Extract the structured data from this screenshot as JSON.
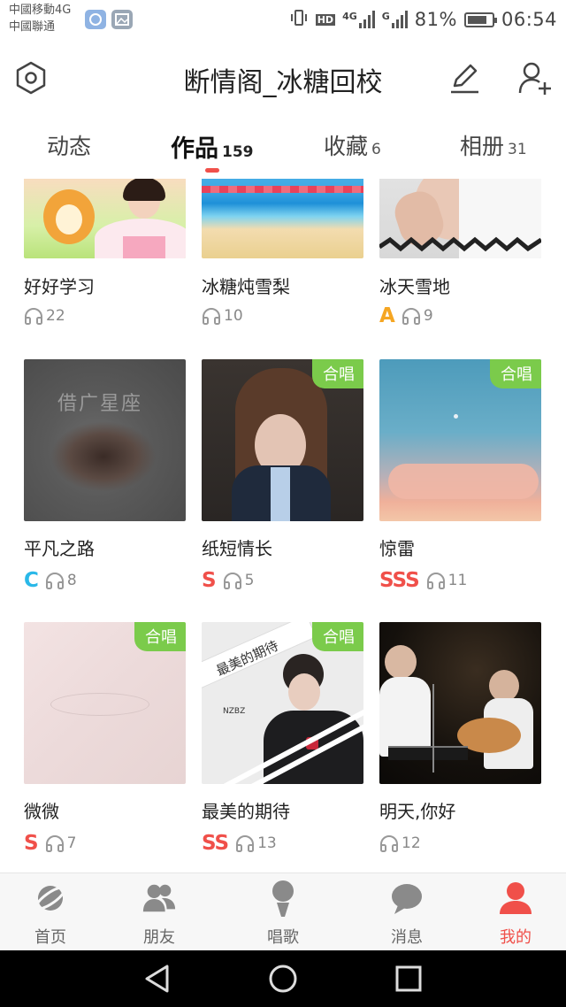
{
  "status_bar": {
    "carrier1": "中國移動4G",
    "carrier2": "中國聯通",
    "hd": "HD",
    "net1": "4G",
    "net2": "G",
    "battery": "81%",
    "battery_level": 0.81,
    "time": "06:54"
  },
  "header": {
    "title": "断情阁_冰糖回校",
    "left_icon": "settings-hexagon-icon",
    "right_icons": [
      "edit-pencil-icon",
      "add-friend-icon"
    ]
  },
  "tabs": [
    {
      "label": "动态",
      "count": ""
    },
    {
      "label": "作品",
      "count": "159",
      "active": true
    },
    {
      "label": "收藏",
      "count": "6"
    },
    {
      "label": "相册",
      "count": "31"
    }
  ],
  "duet_label": "合唱",
  "works": [
    {
      "title": "好好学习",
      "grade": "",
      "plays": "22",
      "duet": false
    },
    {
      "title": "冰糖炖雪梨",
      "grade": "",
      "plays": "10",
      "duet": false
    },
    {
      "title": "冰天雪地",
      "grade": "A",
      "plays": "9",
      "duet": false
    },
    {
      "title": "平凡之路",
      "grade": "C",
      "plays": "8",
      "duet": false
    },
    {
      "title": "纸短情长",
      "grade": "S",
      "plays": "5",
      "duet": true
    },
    {
      "title": "惊雷",
      "grade": "SSS",
      "plays": "11",
      "duet": true
    },
    {
      "title": "微微",
      "grade": "S",
      "plays": "7",
      "duet": true
    },
    {
      "title": "最美的期待",
      "grade": "SS",
      "plays": "13",
      "duet": true
    },
    {
      "title": "明天,你好",
      "grade": "",
      "plays": "12",
      "duet": false
    }
  ],
  "cover_texts": {
    "w3": "借广星座",
    "w7_banner": "最美的期待",
    "w7_tag": "NZBZ"
  },
  "grade_colors": {
    "A": "#f5a623",
    "C": "#2ab8e8",
    "S": "#f0504a",
    "SS": "#f0504a",
    "SSS": "#f0504a"
  },
  "bottom_nav": [
    {
      "label": "首页",
      "icon": "planet-icon"
    },
    {
      "label": "朋友",
      "icon": "friends-icon"
    },
    {
      "label": "唱歌",
      "icon": "microphone-icon"
    },
    {
      "label": "消息",
      "icon": "message-bubble-icon"
    },
    {
      "label": "我的",
      "icon": "user-icon",
      "active": true
    }
  ],
  "system_nav": [
    "back-icon",
    "home-icon",
    "recents-icon"
  ],
  "colors": {
    "accent": "#f0504a",
    "duet_green": "#7bcb4b"
  }
}
